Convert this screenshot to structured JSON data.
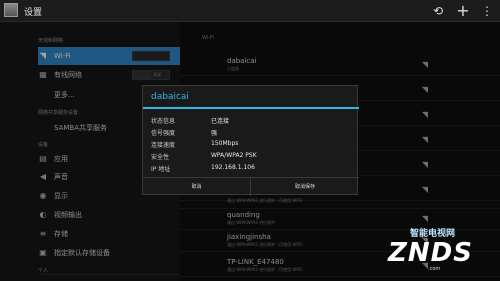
{
  "titlebar": {
    "title": "设置"
  },
  "sidebar": {
    "sections": [
      {
        "id": "wireless",
        "label": "无线和网络"
      },
      {
        "id": "sharing",
        "label": "网络共享服务设置"
      },
      {
        "id": "device",
        "label": "设备"
      },
      {
        "id": "personal",
        "label": "个人"
      }
    ],
    "items": [
      {
        "label": "Wi-Fi",
        "icon": "wifi-icon",
        "toggle": ""
      },
      {
        "label": "有线网络",
        "icon": "ethernet-icon",
        "toggle": "关闭"
      },
      {
        "label": "更多..."
      },
      {
        "label": "SAMBA共享服务"
      },
      {
        "label": "应用",
        "icon": "apps-icon"
      },
      {
        "label": "声音",
        "icon": "sound-icon"
      },
      {
        "label": "显示",
        "icon": "display-icon"
      },
      {
        "label": "视频输出",
        "icon": "video-output-icon"
      },
      {
        "label": "存储",
        "icon": "storage-icon"
      },
      {
        "label": "指定默认存储设备",
        "icon": "default-storage-icon"
      }
    ]
  },
  "content": {
    "header": "Wi-Fi",
    "networks": [
      {
        "name": "dabaicai",
        "status": "已连接"
      },
      {
        "name": "",
        "status": ""
      },
      {
        "name": "",
        "status": ""
      },
      {
        "name": "",
        "status": ""
      },
      {
        "name": "",
        "status": ""
      },
      {
        "name": "",
        "status": ""
      },
      {
        "name": "",
        "status": "通过 WPA/WPA2 进行保护（可使用 WPS）"
      },
      {
        "name": "quanding",
        "status": "通过 WPA/WPA2 进行保护"
      },
      {
        "name": "jiaxingjinsha",
        "status": "通过 WPA/WPA2 进行保护（可使用 WPS）"
      },
      {
        "name": "TP-LINK_E47480",
        "status": "通过 WPA/WPA2 进行保护（可使用 WPS）"
      }
    ]
  },
  "dialog": {
    "title": "dabaicai",
    "fields": [
      {
        "key": "状态信息",
        "value": "已连接"
      },
      {
        "key": "信号强度",
        "value": "强"
      },
      {
        "key": "连接速度",
        "value": "150Mbps"
      },
      {
        "key": "安全性",
        "value": "WPA/WPA2 PSK"
      },
      {
        "key": "IP 地址",
        "value": "192.168.1.106"
      }
    ],
    "cancel_label": "取消",
    "forget_label": "取消保存"
  },
  "watermark": {
    "zh": "智能电视网",
    "en": "ZNDS",
    "url": ".com"
  },
  "colors": {
    "accent": "#34b5e5",
    "selected": "#2e88c8",
    "background": "#111111"
  }
}
